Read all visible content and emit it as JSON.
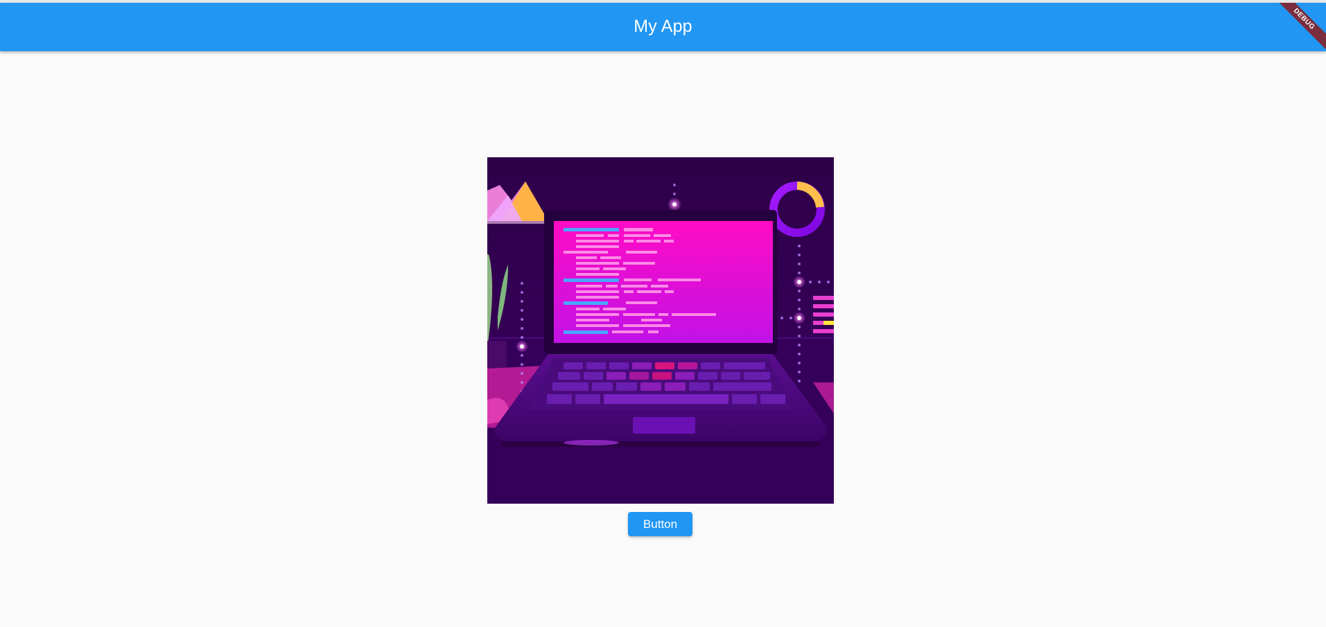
{
  "appbar": {
    "title": "My App",
    "background": "#2196f3"
  },
  "debug_banner": {
    "label": "DEBUG",
    "color": "#7a2d3d"
  },
  "content": {
    "image_icon": "laptop-illustration",
    "button_label": "Button"
  }
}
